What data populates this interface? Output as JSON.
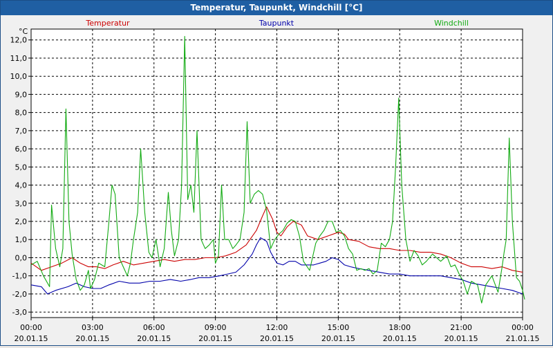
{
  "window": {
    "title": "Temperatur, Taupunkt, Windchill [°C]"
  },
  "colors": {
    "titlebar": "#1f5fa3",
    "background": "#f0f0f0",
    "plot_background": "#ffffff",
    "grid": "#000000",
    "temperatur": "#cc0000",
    "taupunkt": "#0000aa",
    "windchill": "#11aa11"
  },
  "chart_data": {
    "type": "line",
    "title": "Temperatur, Taupunkt, Windchill [°C]",
    "ylabel": "°C",
    "ylim": [
      -3.3,
      12.6
    ],
    "yticks": [
      -3,
      -2,
      -1,
      0,
      1,
      2,
      3,
      4,
      5,
      6,
      7,
      8,
      9,
      10,
      11,
      12
    ],
    "ytick_labels": [
      "-3,0",
      "-2,0",
      "-1,0",
      "0,0",
      "1,0",
      "2,0",
      "3,0",
      "4,0",
      "5,0",
      "6,0",
      "7,0",
      "8,0",
      "9,0",
      "10,0",
      "11,0",
      "12,0"
    ],
    "xlim": [
      0,
      24
    ],
    "xticks": [
      0,
      3,
      6,
      9,
      12,
      15,
      18,
      21,
      24
    ],
    "xtick_labels": [
      [
        "00:00",
        "20.01.15"
      ],
      [
        "03:00",
        "20.01.15"
      ],
      [
        "06:00",
        "20.01.15"
      ],
      [
        "09:00",
        "20.01.15"
      ],
      [
        "12:00",
        "20.01.15"
      ],
      [
        "15:00",
        "20.01.15"
      ],
      [
        "18:00",
        "20.01.15"
      ],
      [
        "21:00",
        "20.01.15"
      ],
      [
        "00:00",
        "21.01.15"
      ]
    ],
    "grid": true,
    "legend_placement": "top",
    "series": [
      {
        "name": "Temperatur",
        "color": "#cc0000",
        "points": [
          [
            0,
            -0.3
          ],
          [
            0.5,
            -0.7
          ],
          [
            1.0,
            -0.5
          ],
          [
            1.5,
            -0.3
          ],
          [
            2.0,
            0.0
          ],
          [
            2.4,
            -0.3
          ],
          [
            2.8,
            -0.5
          ],
          [
            3.2,
            -0.5
          ],
          [
            3.6,
            -0.6
          ],
          [
            4.0,
            -0.4
          ],
          [
            4.5,
            -0.2
          ],
          [
            5.0,
            -0.4
          ],
          [
            5.5,
            -0.3
          ],
          [
            6.0,
            -0.2
          ],
          [
            6.5,
            -0.1
          ],
          [
            7.0,
            -0.2
          ],
          [
            7.5,
            -0.1
          ],
          [
            8.0,
            -0.1
          ],
          [
            8.5,
            0.0
          ],
          [
            9.0,
            0.0
          ],
          [
            9.5,
            0.1
          ],
          [
            10.0,
            0.3
          ],
          [
            10.5,
            0.7
          ],
          [
            11.0,
            1.5
          ],
          [
            11.3,
            2.3
          ],
          [
            11.5,
            2.8
          ],
          [
            11.8,
            2.1
          ],
          [
            12.0,
            1.4
          ],
          [
            12.2,
            1.2
          ],
          [
            12.5,
            1.7
          ],
          [
            12.8,
            2.0
          ],
          [
            13.2,
            1.8
          ],
          [
            13.5,
            1.2
          ],
          [
            14.0,
            1.0
          ],
          [
            14.5,
            1.2
          ],
          [
            15.0,
            1.4
          ],
          [
            15.3,
            1.3
          ],
          [
            15.5,
            1.0
          ],
          [
            16.0,
            0.9
          ],
          [
            16.5,
            0.6
          ],
          [
            17.0,
            0.5
          ],
          [
            17.5,
            0.5
          ],
          [
            18.0,
            0.4
          ],
          [
            18.5,
            0.4
          ],
          [
            19.0,
            0.3
          ],
          [
            19.5,
            0.3
          ],
          [
            20.0,
            0.2
          ],
          [
            20.5,
            0.0
          ],
          [
            21.0,
            -0.3
          ],
          [
            21.5,
            -0.5
          ],
          [
            22.0,
            -0.5
          ],
          [
            22.5,
            -0.6
          ],
          [
            23.0,
            -0.5
          ],
          [
            23.5,
            -0.7
          ],
          [
            24.0,
            -0.8
          ]
        ]
      },
      {
        "name": "Taupunkt",
        "color": "#0000aa",
        "points": [
          [
            0,
            -1.5
          ],
          [
            0.5,
            -1.6
          ],
          [
            0.8,
            -2.0
          ],
          [
            1.2,
            -1.8
          ],
          [
            1.8,
            -1.6
          ],
          [
            2.2,
            -1.4
          ],
          [
            2.6,
            -1.6
          ],
          [
            3.0,
            -1.7
          ],
          [
            3.4,
            -1.7
          ],
          [
            3.8,
            -1.5
          ],
          [
            4.3,
            -1.3
          ],
          [
            4.8,
            -1.4
          ],
          [
            5.3,
            -1.4
          ],
          [
            5.8,
            -1.3
          ],
          [
            6.3,
            -1.3
          ],
          [
            6.8,
            -1.2
          ],
          [
            7.3,
            -1.3
          ],
          [
            7.8,
            -1.2
          ],
          [
            8.2,
            -1.1
          ],
          [
            8.7,
            -1.1
          ],
          [
            9.2,
            -1.0
          ],
          [
            9.6,
            -0.9
          ],
          [
            10.0,
            -0.8
          ],
          [
            10.4,
            -0.4
          ],
          [
            10.8,
            0.2
          ],
          [
            11.0,
            0.7
          ],
          [
            11.2,
            1.1
          ],
          [
            11.5,
            0.9
          ],
          [
            11.7,
            0.3
          ],
          [
            12.0,
            -0.3
          ],
          [
            12.3,
            -0.4
          ],
          [
            12.6,
            -0.2
          ],
          [
            12.9,
            -0.2
          ],
          [
            13.2,
            -0.4
          ],
          [
            13.5,
            -0.4
          ],
          [
            13.8,
            -0.4
          ],
          [
            14.1,
            -0.3
          ],
          [
            14.4,
            -0.2
          ],
          [
            14.7,
            0.0
          ],
          [
            15.0,
            -0.1
          ],
          [
            15.3,
            -0.4
          ],
          [
            15.6,
            -0.5
          ],
          [
            16.0,
            -0.6
          ],
          [
            16.5,
            -0.7
          ],
          [
            17.0,
            -0.8
          ],
          [
            17.5,
            -0.9
          ],
          [
            18.0,
            -0.9
          ],
          [
            18.5,
            -1.0
          ],
          [
            19.0,
            -1.0
          ],
          [
            19.5,
            -1.0
          ],
          [
            20.0,
            -1.0
          ],
          [
            20.5,
            -1.1
          ],
          [
            21.0,
            -1.2
          ],
          [
            21.5,
            -1.4
          ],
          [
            22.0,
            -1.5
          ],
          [
            22.5,
            -1.6
          ],
          [
            23.0,
            -1.7
          ],
          [
            23.5,
            -1.8
          ],
          [
            24.0,
            -2.0
          ]
        ]
      },
      {
        "name": "Windchill",
        "color": "#11aa11",
        "points": [
          [
            0,
            -0.4
          ],
          [
            0.3,
            -0.2
          ],
          [
            0.6,
            -1.0
          ],
          [
            0.9,
            -1.6
          ],
          [
            1.0,
            2.9
          ],
          [
            1.2,
            0.5
          ],
          [
            1.4,
            -0.5
          ],
          [
            1.55,
            0.5
          ],
          [
            1.7,
            8.2
          ],
          [
            1.85,
            2.0
          ],
          [
            2.0,
            0.2
          ],
          [
            2.2,
            -1.2
          ],
          [
            2.4,
            -1.8
          ],
          [
            2.6,
            -1.5
          ],
          [
            2.8,
            -0.7
          ],
          [
            2.9,
            -1.7
          ],
          [
            3.1,
            -1.2
          ],
          [
            3.3,
            -0.3
          ],
          [
            3.6,
            -0.5
          ],
          [
            3.8,
            2.0
          ],
          [
            3.95,
            4.0
          ],
          [
            4.1,
            3.5
          ],
          [
            4.3,
            0.0
          ],
          [
            4.5,
            -0.5
          ],
          [
            4.7,
            -1.0
          ],
          [
            4.85,
            -0.3
          ],
          [
            5.0,
            1.0
          ],
          [
            5.2,
            2.5
          ],
          [
            5.35,
            6.0
          ],
          [
            5.55,
            2.5
          ],
          [
            5.75,
            0.3
          ],
          [
            5.9,
            0.0
          ],
          [
            6.1,
            1.0
          ],
          [
            6.3,
            -0.5
          ],
          [
            6.5,
            0.5
          ],
          [
            6.7,
            3.6
          ],
          [
            6.85,
            1.5
          ],
          [
            7.0,
            0.1
          ],
          [
            7.2,
            1.0
          ],
          [
            7.35,
            4.0
          ],
          [
            7.5,
            12.2
          ],
          [
            7.65,
            3.2
          ],
          [
            7.8,
            4.0
          ],
          [
            7.95,
            2.5
          ],
          [
            8.1,
            7.0
          ],
          [
            8.3,
            1.0
          ],
          [
            8.5,
            0.5
          ],
          [
            8.7,
            0.7
          ],
          [
            8.9,
            1.0
          ],
          [
            9.0,
            -0.3
          ],
          [
            9.15,
            0.1
          ],
          [
            9.3,
            4.0
          ],
          [
            9.45,
            1.0
          ],
          [
            9.65,
            1.0
          ],
          [
            9.85,
            0.5
          ],
          [
            10.0,
            0.7
          ],
          [
            10.2,
            1.0
          ],
          [
            10.4,
            2.5
          ],
          [
            10.55,
            7.5
          ],
          [
            10.7,
            3.0
          ],
          [
            10.9,
            3.5
          ],
          [
            11.1,
            3.7
          ],
          [
            11.3,
            3.5
          ],
          [
            11.5,
            2.6
          ],
          [
            11.7,
            0.5
          ],
          [
            11.9,
            1.0
          ],
          [
            12.1,
            1.3
          ],
          [
            12.3,
            1.5
          ],
          [
            12.5,
            1.9
          ],
          [
            12.7,
            2.1
          ],
          [
            12.9,
            2.0
          ],
          [
            13.1,
            1.2
          ],
          [
            13.3,
            -0.2
          ],
          [
            13.6,
            -0.7
          ],
          [
            13.9,
            0.8
          ],
          [
            14.1,
            1.2
          ],
          [
            14.3,
            1.5
          ],
          [
            14.5,
            2.0
          ],
          [
            14.7,
            2.0
          ],
          [
            14.9,
            1.4
          ],
          [
            15.1,
            1.5
          ],
          [
            15.3,
            1.2
          ],
          [
            15.5,
            0.5
          ],
          [
            15.7,
            0.2
          ],
          [
            15.9,
            -0.7
          ],
          [
            16.1,
            -0.6
          ],
          [
            16.3,
            -0.7
          ],
          [
            16.5,
            -0.6
          ],
          [
            16.7,
            -0.9
          ],
          [
            16.9,
            -0.7
          ],
          [
            17.1,
            0.8
          ],
          [
            17.3,
            0.6
          ],
          [
            17.5,
            1.0
          ],
          [
            17.65,
            2.0
          ],
          [
            17.8,
            5.0
          ],
          [
            17.95,
            8.8
          ],
          [
            18.1,
            4.0
          ],
          [
            18.3,
            1.0
          ],
          [
            18.5,
            -0.2
          ],
          [
            18.7,
            0.4
          ],
          [
            18.9,
            0.1
          ],
          [
            19.1,
            -0.4
          ],
          [
            19.3,
            -0.2
          ],
          [
            19.6,
            0.2
          ],
          [
            19.8,
            0.0
          ],
          [
            20.0,
            -0.2
          ],
          [
            20.3,
            0.1
          ],
          [
            20.5,
            -0.5
          ],
          [
            20.7,
            -0.4
          ],
          [
            20.9,
            -0.9
          ],
          [
            21.1,
            -1.3
          ],
          [
            21.3,
            -2.0
          ],
          [
            21.5,
            -1.3
          ],
          [
            21.8,
            -1.5
          ],
          [
            22.0,
            -2.5
          ],
          [
            22.2,
            -1.5
          ],
          [
            22.5,
            -1.0
          ],
          [
            22.8,
            -1.9
          ],
          [
            23.0,
            -0.5
          ],
          [
            23.1,
            0.3
          ],
          [
            23.2,
            1.0
          ],
          [
            23.35,
            6.6
          ],
          [
            23.5,
            2.0
          ],
          [
            23.7,
            -1.1
          ],
          [
            23.85,
            -1.3
          ],
          [
            24.0,
            -1.8
          ],
          [
            24.1,
            -2.3
          ]
        ]
      }
    ]
  }
}
